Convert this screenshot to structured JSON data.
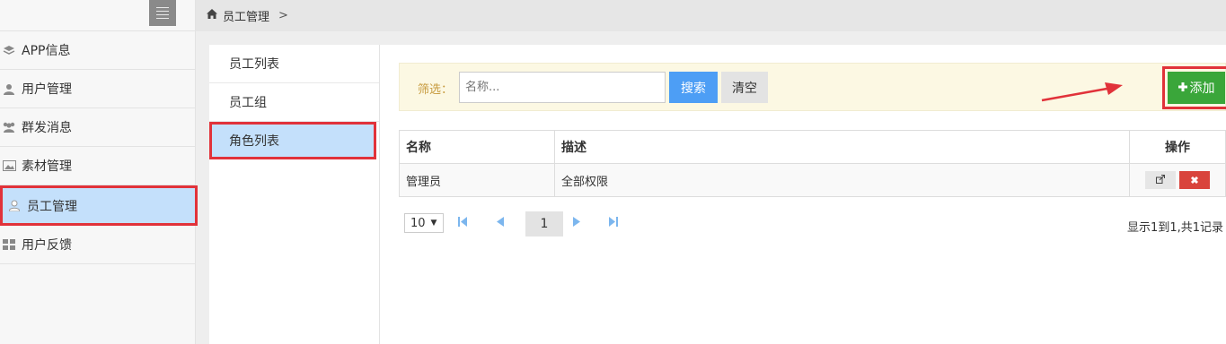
{
  "sidebar": {
    "items": [
      {
        "label": "APP信息",
        "icon": "layers-icon"
      },
      {
        "label": "用户管理",
        "icon": "user-icon"
      },
      {
        "label": "群发消息",
        "icon": "users-icon"
      },
      {
        "label": "素材管理",
        "icon": "image-icon"
      },
      {
        "label": "员工管理",
        "icon": "staff-icon",
        "active": true
      },
      {
        "label": "用户反馈",
        "icon": "grid-icon"
      }
    ]
  },
  "breadcrumb": {
    "label": "员工管理",
    "separator": ">"
  },
  "subnav": {
    "items": [
      {
        "label": "员工列表"
      },
      {
        "label": "员工组"
      },
      {
        "label": "角色列表",
        "active": true
      }
    ]
  },
  "filter": {
    "label": "筛选：",
    "placeholder": "名称...",
    "search_label": "搜索",
    "clear_label": "清空",
    "add_label": "添加"
  },
  "table": {
    "headers": [
      "名称",
      "描述",
      "操作"
    ],
    "rows": [
      {
        "name": "管理员",
        "desc": "全部权限"
      }
    ]
  },
  "pager": {
    "page_size": "10",
    "current_page": "1",
    "info": "显示1到1,共1记录"
  },
  "colors": {
    "accent_blue": "#4d9ef5",
    "add_green": "#3aa63a",
    "highlight_red": "#e1323a",
    "active_bg": "#c4e0fb"
  }
}
